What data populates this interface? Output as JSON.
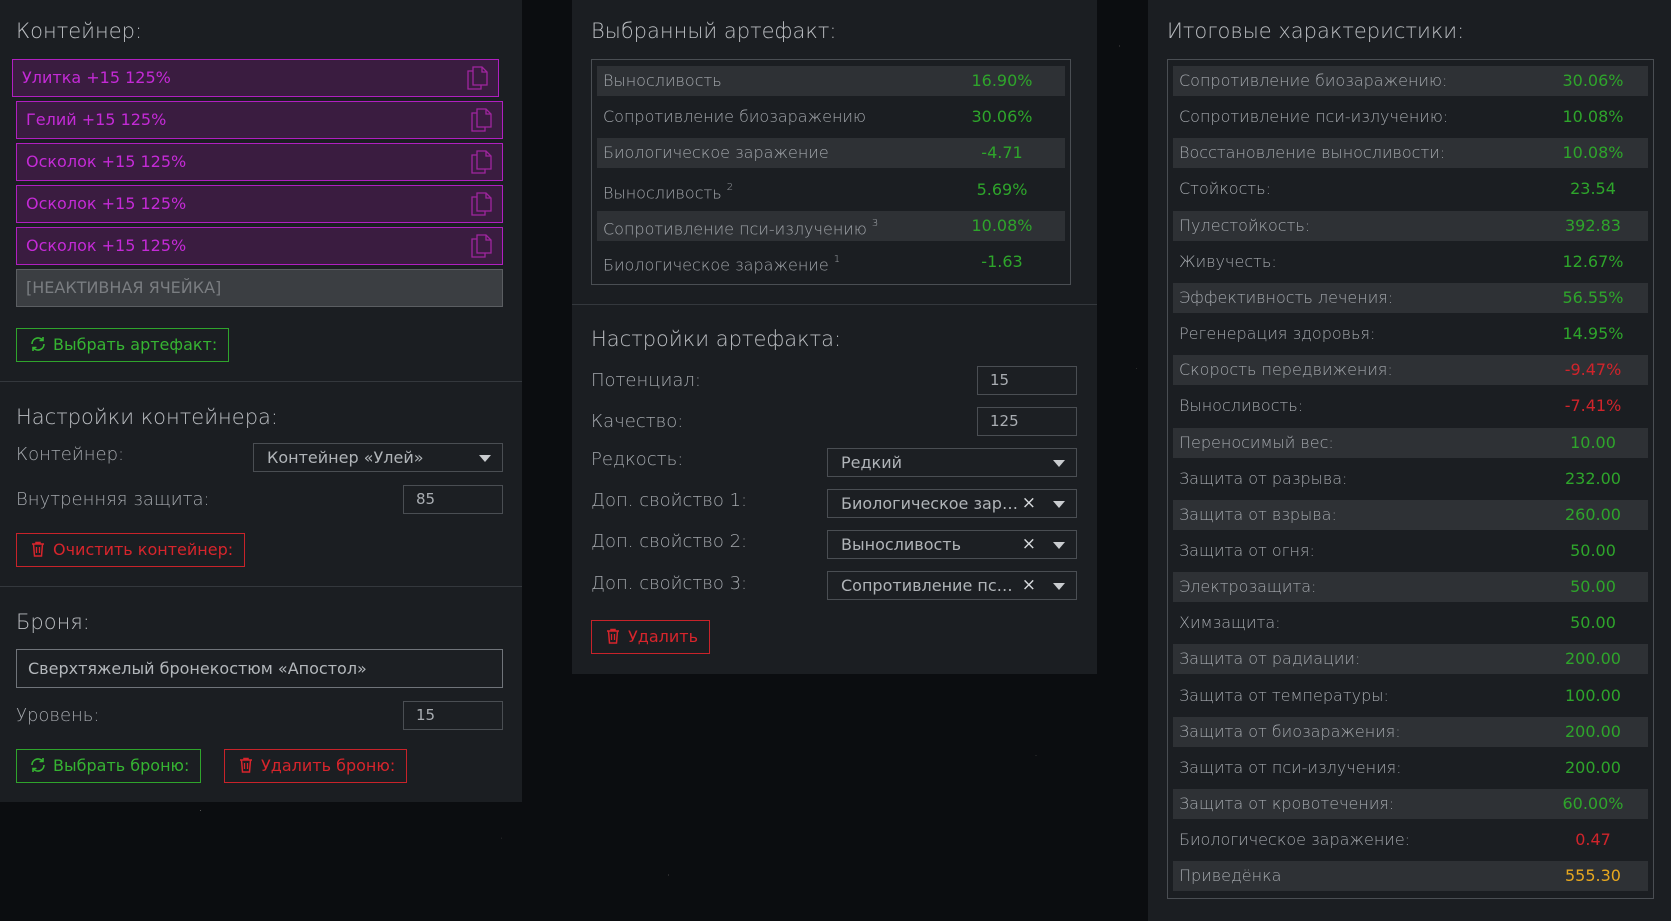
{
  "left": {
    "container_title": "Контейнер:",
    "slots": [
      {
        "label": "Улитка +15 125%"
      },
      {
        "label": "Гелий +15 125%"
      },
      {
        "label": "Осколок +15 125%"
      },
      {
        "label": "Осколок +15 125%"
      },
      {
        "label": "Осколок +15 125%"
      }
    ],
    "inactive_slot": "[НЕАКТИВНАЯ ЯЧЕЙКА]",
    "select_artifact_btn": "Выбрать артефакт:",
    "container_settings_title": "Настройки контейнера:",
    "container_label": "Контейнер:",
    "container_value": "Контейнер «Улей»",
    "inner_protection_label": "Внутренняя защита:",
    "inner_protection_value": "85",
    "clear_container_btn": "Очистить контейнер:",
    "armor_title": "Броня:",
    "armor_value": "Сверхтяжелый бронекостюм «Апостол»",
    "level_label": "Уровень:",
    "level_value": "15",
    "select_armor_btn": "Выбрать броню:",
    "delete_armor_btn": "Удалить броню:"
  },
  "mid": {
    "selected_title": "Выбранный артефакт:",
    "stats": [
      {
        "name": "Выносливость",
        "sup": "",
        "value": "16.90%",
        "color": "#2ea52b"
      },
      {
        "name": "Сопротивление биозаражению",
        "sup": "",
        "value": "30.06%",
        "color": "#2ea52b"
      },
      {
        "name": "Биологическое заражение",
        "sup": "",
        "value": "-4.71",
        "color": "#2ea52b"
      },
      {
        "name": "Выносливость",
        "sup": "2",
        "value": "5.69%",
        "color": "#2ea52b"
      },
      {
        "name": "Сопротивление пси-излучению",
        "sup": "3",
        "value": "10.08%",
        "color": "#2ea52b"
      },
      {
        "name": "Биологическое заражение",
        "sup": "1",
        "value": "-1.63",
        "color": "#2ea52b"
      }
    ],
    "settings_title": "Настройки артефакта:",
    "potential_label": "Потенциал:",
    "potential_value": "15",
    "quality_label": "Качество:",
    "quality_value": "125",
    "rarity_label": "Редкость:",
    "rarity_value": "Редкий",
    "prop1_label": "Доп. свойство 1:",
    "prop1_value": "Биологическое заражение",
    "prop2_label": "Доп. свойство 2:",
    "prop2_value": "Выносливость",
    "prop3_label": "Доп. свойство 3:",
    "prop3_value": "Сопротивление пси-излучению",
    "clear_glyph": "×",
    "delete_btn": "Удалить"
  },
  "right": {
    "title": "Итоговые характеристики:",
    "stats": [
      {
        "name": "Сопротивление биозаражению:",
        "value": "30.06%",
        "color": "#2ea52b"
      },
      {
        "name": "Сопротивление пси-излучению:",
        "value": "10.08%",
        "color": "#2ea52b"
      },
      {
        "name": "Восстановление выносливости:",
        "value": "10.08%",
        "color": "#2ea52b"
      },
      {
        "name": "Стойкость:",
        "value": "23.54",
        "color": "#2ea52b"
      },
      {
        "name": "Пулестойкость:",
        "value": "392.83",
        "color": "#2ea52b"
      },
      {
        "name": "Живучесть:",
        "value": "12.67%",
        "color": "#2ea52b"
      },
      {
        "name": "Эффективность лечения:",
        "value": "56.55%",
        "color": "#2ea52b"
      },
      {
        "name": "Регенерация здоровья:",
        "value": "14.95%",
        "color": "#2ea52b"
      },
      {
        "name": "Скорость передвижения:",
        "value": "-9.47%",
        "color": "#d0242b"
      },
      {
        "name": "Выносливость:",
        "value": "-7.41%",
        "color": "#d0242b"
      },
      {
        "name": "Переносимый вес:",
        "value": "10.00",
        "color": "#2ea52b"
      },
      {
        "name": "Защита от разрыва:",
        "value": "232.00",
        "color": "#2ea52b"
      },
      {
        "name": "Защита от взрыва:",
        "value": "260.00",
        "color": "#2ea52b"
      },
      {
        "name": "Защита от огня:",
        "value": "50.00",
        "color": "#2ea52b"
      },
      {
        "name": "Электрозащита:",
        "value": "50.00",
        "color": "#2ea52b"
      },
      {
        "name": "Химзащита:",
        "value": "50.00",
        "color": "#2ea52b"
      },
      {
        "name": "Защита от радиации:",
        "value": "200.00",
        "color": "#2ea52b"
      },
      {
        "name": "Защита от температуры:",
        "value": "100.00",
        "color": "#2ea52b"
      },
      {
        "name": "Защита от биозаражения:",
        "value": "200.00",
        "color": "#2ea52b"
      },
      {
        "name": "Защита от пси-излучения:",
        "value": "200.00",
        "color": "#2ea52b"
      },
      {
        "name": "Защита от кровотечения:",
        "value": "60.00%",
        "color": "#2ea52b"
      },
      {
        "name": "Биологическое заражение:",
        "value": "0.47",
        "color": "#d0242b"
      },
      {
        "name": "Приведёнка",
        "value": "555.30",
        "color": "#e7a81f"
      }
    ]
  }
}
